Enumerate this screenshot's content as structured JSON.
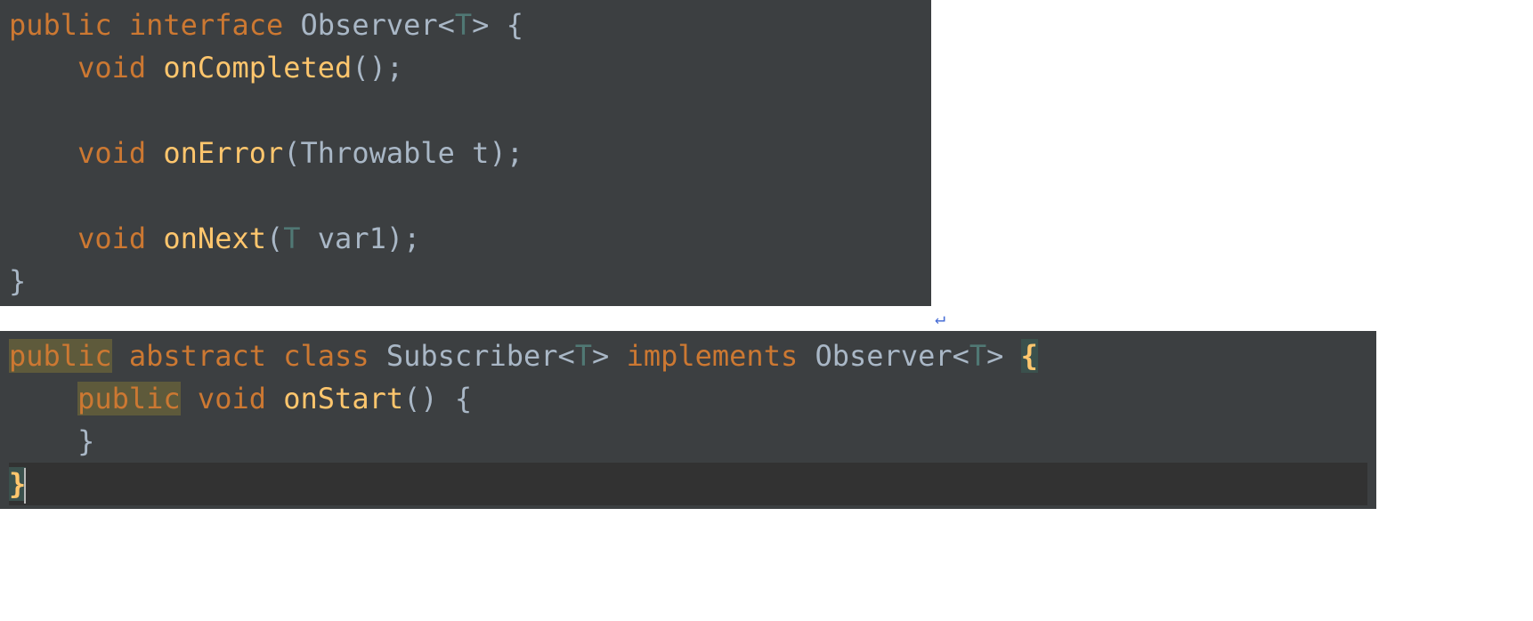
{
  "block1": {
    "line1": {
      "public": "public",
      "interface": "interface",
      "name": "Observer",
      "lt": "<",
      "generic": "T",
      "gt": ">",
      "brace": "{"
    },
    "line2": {
      "indent": "    ",
      "void": "void",
      "method": "onCompleted",
      "parens": "();"
    },
    "line3": {
      "indent": "    ",
      "void": "void",
      "method": "onError",
      "lparen": "(",
      "ptype": "Throwable",
      "pname": "t",
      "rparen": ");"
    },
    "line4": {
      "indent": "    ",
      "void": "void",
      "method": "onNext",
      "lparen": "(",
      "generic": "T",
      "pname": "var1",
      "rparen": ");"
    },
    "line5": {
      "brace": "}"
    }
  },
  "arrow": "↵",
  "block2": {
    "line1": {
      "public": "public",
      "abstract": "abstract",
      "class": "class",
      "name": "Subscriber",
      "lt1": "<",
      "generic1": "T",
      "gt1": ">",
      "implements": "implements",
      "iname": "Observer",
      "lt2": "<",
      "generic2": "T",
      "gt2": ">",
      "brace": "{"
    },
    "line2": {
      "indent": "    ",
      "public": "public",
      "void": "void",
      "method": "onStart",
      "parens": "()",
      "brace": "{"
    },
    "line3": {
      "indent": "    ",
      "brace": "}"
    },
    "line4": {
      "brace": "}"
    }
  }
}
